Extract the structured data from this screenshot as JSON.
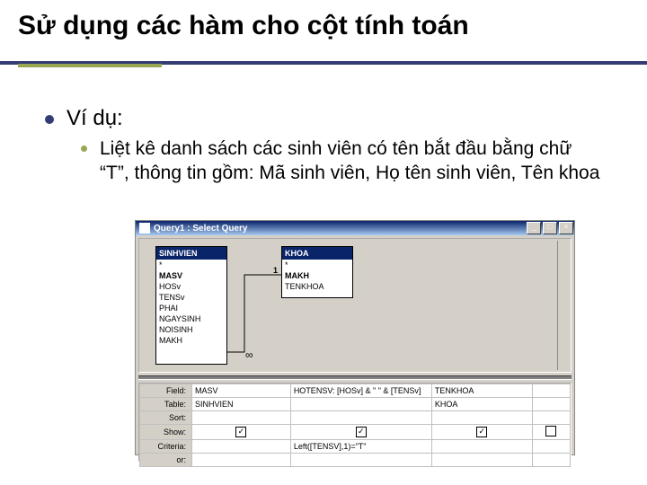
{
  "title": "Sử dụng các hàm cho cột tính toán",
  "bullet1": "Ví dụ:",
  "bullet2": "Liệt kê danh sách các sinh viên có tên bắt đầu bằng chữ “T”, thông tin gồm: Mã sinh viên, Họ tên sinh viên, Tên khoa",
  "window": {
    "title": "Query1 : Select Query",
    "btn_min": "_",
    "btn_max": "□",
    "btn_close": "×"
  },
  "tables": {
    "t1": {
      "name": "SINHVIEN",
      "fields": [
        "*",
        "MASV",
        "HOSv",
        "TENSv",
        "PHAI",
        "NGAYSINH",
        "NOISINH",
        "MAKH"
      ]
    },
    "t2": {
      "name": "KHOA",
      "fields": [
        "*",
        "MAKH",
        "TENKHOA"
      ]
    }
  },
  "join_symbol": "∞",
  "grid": {
    "labels": {
      "field": "Field:",
      "table": "Table:",
      "sort": "Sort:",
      "show": "Show:",
      "criteria": "Criteria:",
      "or": "or:"
    },
    "checkmark": "✓",
    "cols": [
      {
        "field": "MASV",
        "table": "SINHVIEN",
        "show": true,
        "criteria": ""
      },
      {
        "field": "HOTENSV: [HOSv] & \" \" & [TENSv]",
        "table": "",
        "show": true,
        "criteria": "Left([TENSV],1)=\"T\""
      },
      {
        "field": "TENKHOA",
        "table": "KHOA",
        "show": true,
        "criteria": ""
      },
      {
        "field": "",
        "table": "",
        "show": false,
        "criteria": ""
      }
    ]
  }
}
